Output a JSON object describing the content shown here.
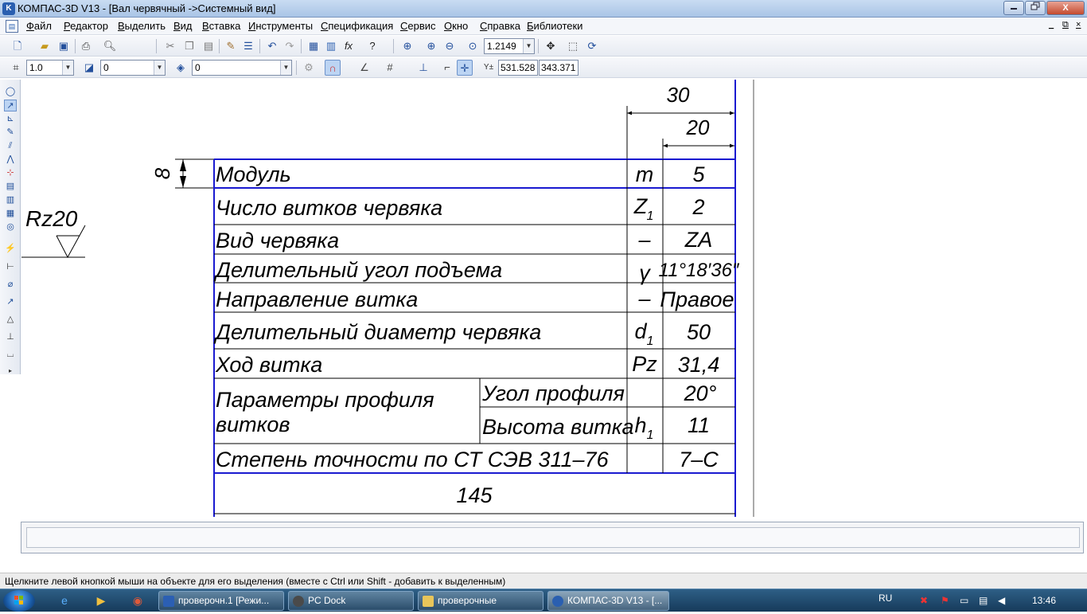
{
  "window": {
    "title": "КОМПАС-3D V13 - [Вал червячный ->Системный вид]",
    "app_icon": "K",
    "min_icon": "minimize-icon",
    "max_icon": "restore-icon",
    "close_label": "X"
  },
  "menu": [
    "Файл",
    "Редактор",
    "Выделить",
    "Вид",
    "Вставка",
    "Инструменты",
    "Спецификация",
    "Сервис",
    "Окно",
    "Справка",
    "Библиотеки"
  ],
  "toolbar1": {
    "zoom_value": "1.2149"
  },
  "toolbar2": {
    "line_scale": "1.0",
    "layer": "0",
    "style": "0",
    "coord_x": "531.528",
    "coord_y": "343.371"
  },
  "drawing": {
    "dim_30": "30",
    "dim_20": "20",
    "dim_8": "8",
    "roughness": "Rz20",
    "dim_145": "145",
    "rows": [
      {
        "label": "Модуль",
        "symbol": "m",
        "value": "5"
      },
      {
        "label": "Число витков червяка",
        "symbol": "Z",
        "symbol_sub": "1",
        "value": "2"
      },
      {
        "label": "Вид червяка",
        "symbol": "–",
        "value": "ZA"
      },
      {
        "label": "Делительный угол подъема",
        "symbol": "γ",
        "value": "11°18′36″"
      },
      {
        "label": "Направление витка",
        "symbol": "–",
        "value": "Правое"
      },
      {
        "label": "Делительный диаметр червяка",
        "symbol": "d",
        "symbol_sub": "1",
        "value": "50"
      },
      {
        "label": "Ход витка",
        "symbol": "Pz",
        "value": "31,4"
      }
    ],
    "profile": {
      "label_line1": "Параметры профиля",
      "label_line2": "витков",
      "sub1_label": "Угол профиля",
      "sub1_value": "20°",
      "sub2_label": "Высота витка",
      "sub2_symbol": "h",
      "sub2_symbol_sub": "1",
      "sub2_value": "11"
    },
    "accuracy": {
      "label": "Степень точности по СТ СЭВ 311–76",
      "value": "7–С"
    }
  },
  "status": {
    "hint": "Щелкните левой кнопкой мыши на объекте для его выделения (вместе с Ctrl или Shift - добавить к выделенным)"
  },
  "taskbar": {
    "items": [
      {
        "label": "проверочн.1 [Режи...",
        "icon": "word-icon",
        "color": "#2b5fb3"
      },
      {
        "label": "PC Dock",
        "icon": "pcdock-icon",
        "color": "#4a4a4a"
      },
      {
        "label": "проверочные",
        "icon": "folder-icon",
        "color": "#e8c55a"
      },
      {
        "label": "КОМПАС-3D V13 - [...",
        "icon": "kompas-icon",
        "color": "#2a5fb0"
      }
    ],
    "lang": "RU",
    "clock": "13:46"
  }
}
